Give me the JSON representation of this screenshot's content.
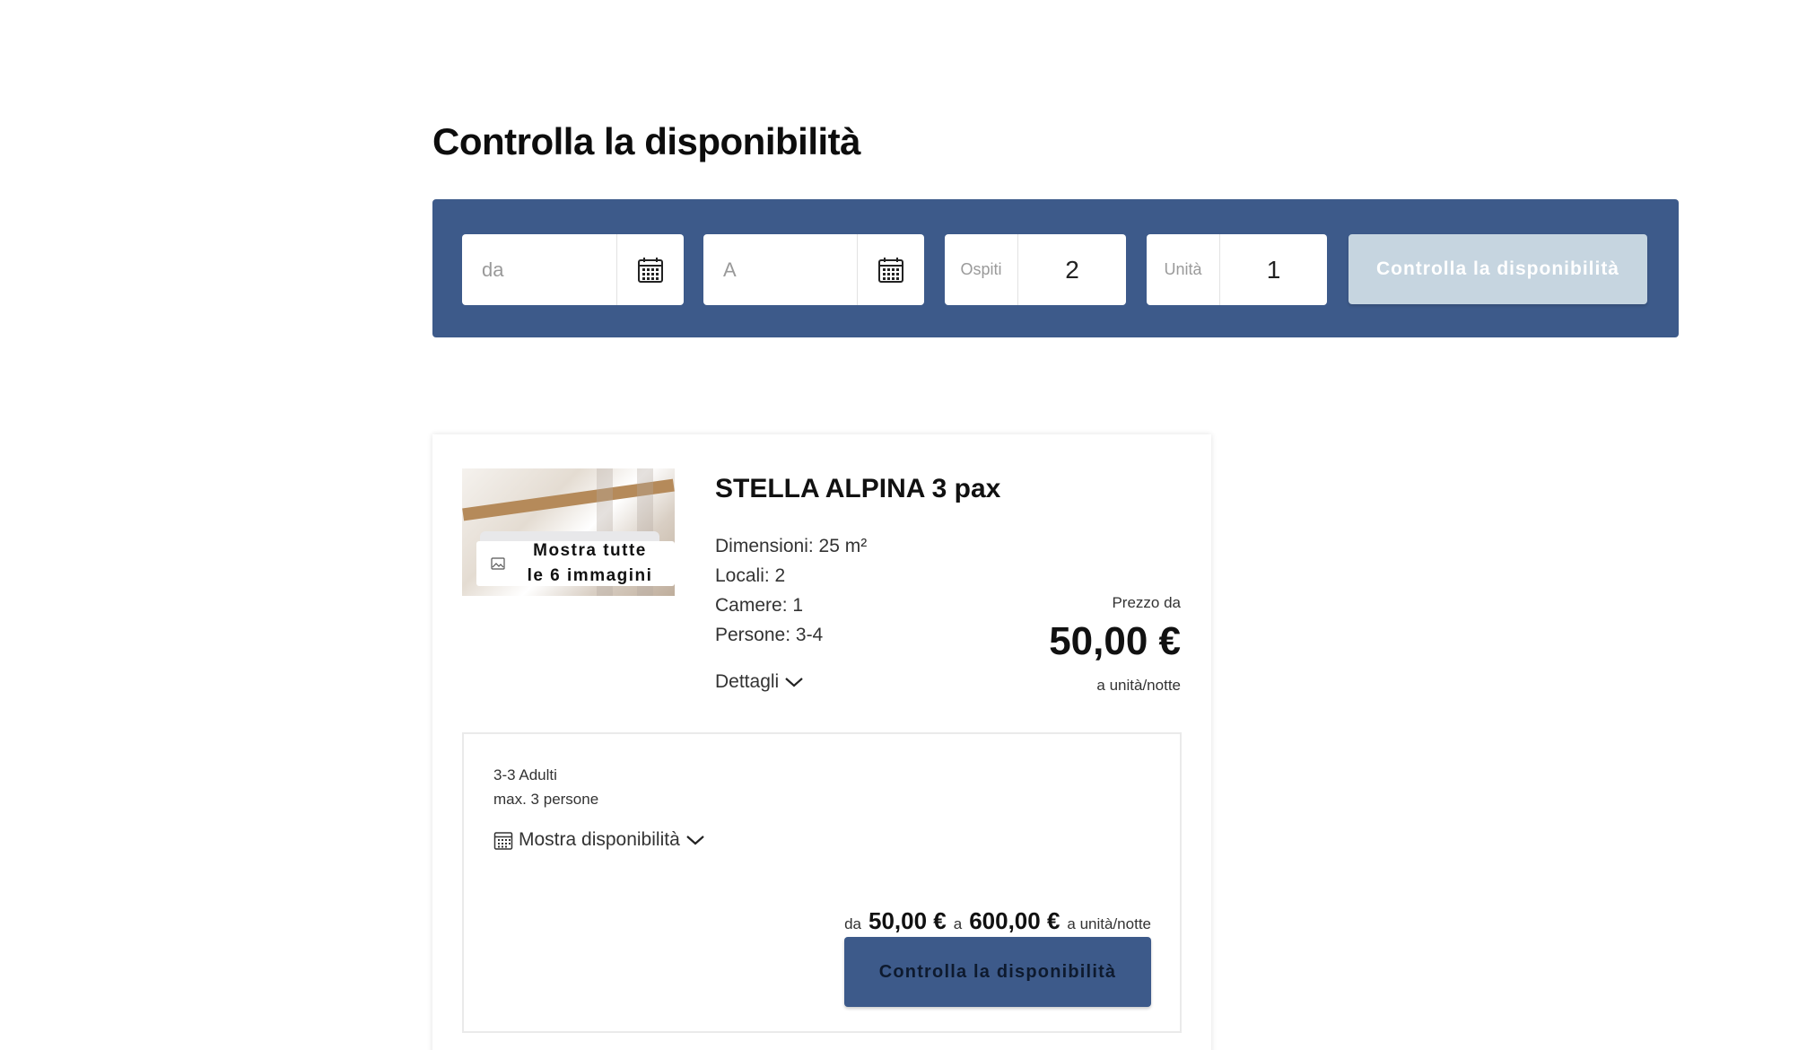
{
  "heading": "Controlla la disponibilità",
  "search": {
    "date_from_placeholder": "da",
    "date_to_placeholder": "A",
    "guests_label": "Ospiti",
    "guests_value": "2",
    "units_label": "Unità",
    "units_value": "1",
    "button_label": "Controlla la disponibilità",
    "bar_color": "#3d5a8a",
    "button_color": "#c6d5e0"
  },
  "listing": {
    "image_overlay": "Mostra tutte\nle 6 immagini",
    "image_overlay_icon": "image-icon",
    "title": "STELLA ALPINA 3 pax",
    "specs": [
      "Dimensioni: 25 m²",
      "Locali: 2",
      "Camere: 1",
      "Persone: 3-4"
    ],
    "details_label": "Dettagli",
    "price_label": "Prezzo da",
    "price": "50,00 €",
    "price_unit": "a unità/notte"
  },
  "rate": {
    "occupancy_line1": "3-3 Adulti",
    "occupancy_line2": "max. 3 persone",
    "availability_label": "Mostra disponibilità",
    "from_label": "da",
    "price_from": "50,00 €",
    "to_label": "a",
    "price_to": "600,00 €",
    "unit_label": "a unità/notte",
    "button_label": "Controlla la disponibilità"
  }
}
